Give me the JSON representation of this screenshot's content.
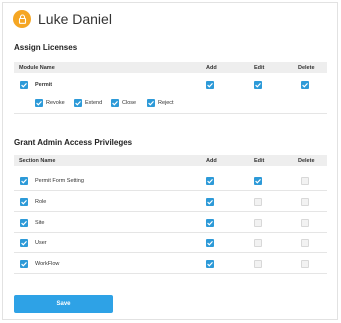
{
  "user": {
    "name": "Luke Daniel",
    "avatar_icon": "lock-icon",
    "avatar_color": "#f5a623"
  },
  "licenses": {
    "title": "Assign Licenses",
    "columns": {
      "name": "Module Name",
      "add": "Add",
      "edit": "Edit",
      "delete": "Delete"
    },
    "module": {
      "label": "Permit",
      "add": true,
      "edit": true,
      "delete": true
    },
    "sub_permissions": [
      {
        "label": "Revoke",
        "checked": true
      },
      {
        "label": "Extend",
        "checked": true
      },
      {
        "label": "Close",
        "checked": true
      },
      {
        "label": "Reject",
        "checked": true
      }
    ]
  },
  "admin": {
    "title": "Grant Admin Access Privileges",
    "columns": {
      "name": "Section Name",
      "add": "Add",
      "edit": "Edit",
      "delete": "Delete"
    },
    "rows": [
      {
        "label": "Permit Form Setting",
        "selected": true,
        "add": true,
        "edit": true,
        "delete": false
      },
      {
        "label": "Role",
        "selected": true,
        "add": true,
        "edit": false,
        "delete": false
      },
      {
        "label": "Site",
        "selected": true,
        "add": true,
        "edit": false,
        "delete": false
      },
      {
        "label": "User",
        "selected": true,
        "add": true,
        "edit": false,
        "delete": false
      },
      {
        "label": "WorkFlow",
        "selected": true,
        "add": true,
        "edit": false,
        "delete": false
      }
    ]
  },
  "save_label": "Save",
  "colors": {
    "accent": "#2d9ad8",
    "button": "#2ea2e6"
  }
}
